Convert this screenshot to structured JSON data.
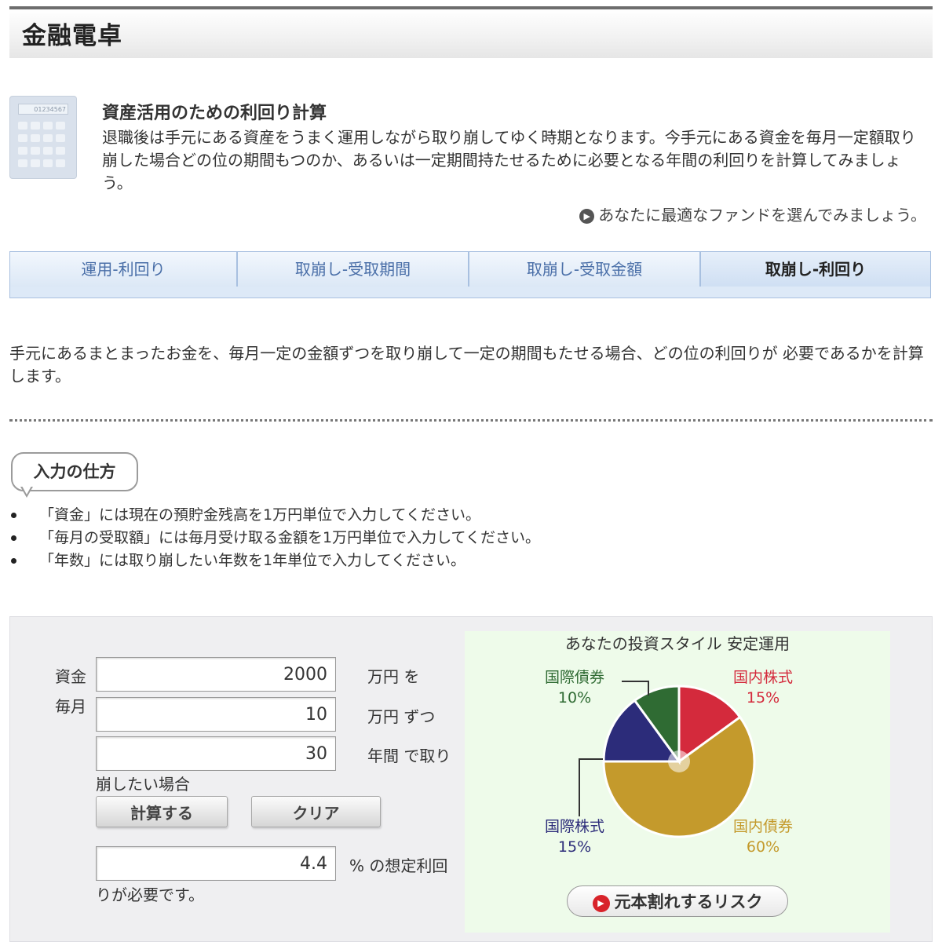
{
  "header": {
    "title": "金融電卓"
  },
  "calc_icon": {
    "screen_text": "01234567"
  },
  "intro": {
    "heading": "資産活用のための利回り計算",
    "text": "退職後は手元にある資産をうまく運用しながら取り崩してゆく時期となります。今手元にある資金を毎月一定額取り崩した場合どの位の期間もつのか、あるいは一定期間持たせるために必要となる年間の利回りを計算してみましょう。",
    "link": "あなたに最適なファンドを選んでみましょう。"
  },
  "tabs": [
    {
      "label": "運用-利回り",
      "active": false
    },
    {
      "label": "取崩し-受取期間",
      "active": false
    },
    {
      "label": "取崩し-受取金額",
      "active": false
    },
    {
      "label": "取崩し-利回り",
      "active": true
    }
  ],
  "description": "手元にあるまとまったお金を、毎月一定の金額ずつを取り崩して一定の期間もたせる場合、どの位の利回りが 必要であるかを計算します。",
  "howto": {
    "title": "入力の仕方",
    "items": [
      "「資金」には現在の預貯金残高を1万円単位で入力してください。",
      "「毎月の受取額」には毎月受け取る金額を1万円単位で入力してください。",
      "「年数」には取り崩したい年数を1年単位で入力してください。"
    ]
  },
  "calculator": {
    "label_fund": "資金",
    "label_monthly": "毎月",
    "fund_value": "2000",
    "fund_unit": "万円 を",
    "monthly_value": "10",
    "monthly_unit": "万円 ずつ",
    "years_value": "30",
    "years_unit": "年間 で取り",
    "years_suffix": "崩したい場合",
    "calc_button": "計算する",
    "clear_button": "クリア",
    "result_value": "4.4",
    "result_unit": "% の想定利回",
    "result_suffix": "りが必要です。"
  },
  "chart_data": {
    "type": "pie",
    "title": "あなたの投資スタイル 安定運用",
    "slices": [
      {
        "name": "国内株式",
        "value": 15,
        "label": "15%",
        "color": "#d42a3c"
      },
      {
        "name": "国内債券",
        "value": 60,
        "label": "60%",
        "color": "#c49a2c"
      },
      {
        "name": "国際株式",
        "value": 15,
        "label": "15%",
        "color": "#2c2c7a"
      },
      {
        "name": "国際債券",
        "value": 10,
        "label": "10%",
        "color": "#2f6b33"
      }
    ]
  },
  "risk_button": "元本割れするリスク"
}
